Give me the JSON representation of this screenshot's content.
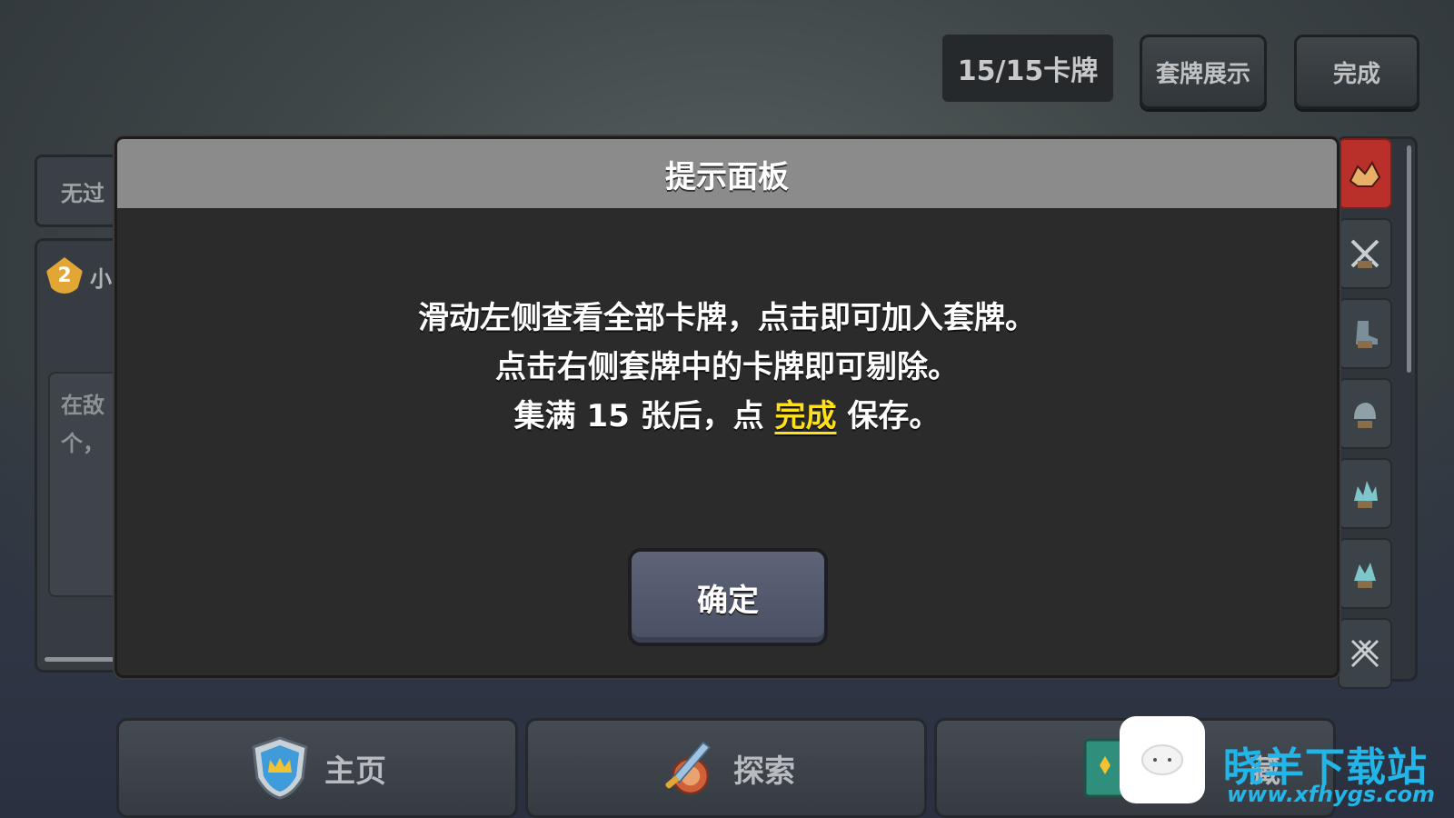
{
  "top_bar": {
    "card_count": "15/15卡牌",
    "deck_show_label": "套牌展示",
    "done_label": "完成"
  },
  "left_panel": {
    "tab_label": "无过",
    "badge_level": "2",
    "card_name": "小",
    "desc_line1": "在敌",
    "desc_line2": "个，"
  },
  "modal": {
    "title": "提示面板",
    "line1": "滑动左侧查看全部卡牌，点击即可加入套牌。",
    "line2": "点击右侧套牌中的卡牌即可剔除。",
    "line3_prefix": "集满 15 张后，点 ",
    "line3_highlight": "完成",
    "line3_suffix": " 保存。",
    "confirm_label": "确定",
    "highlight_color": "#ffe11a"
  },
  "bottom_nav": {
    "home_label": "主页",
    "explore_label": "探索",
    "third_label": "藏"
  },
  "watermark": {
    "brand": "晓羊下载站",
    "url": "www.xfhygs.com"
  }
}
